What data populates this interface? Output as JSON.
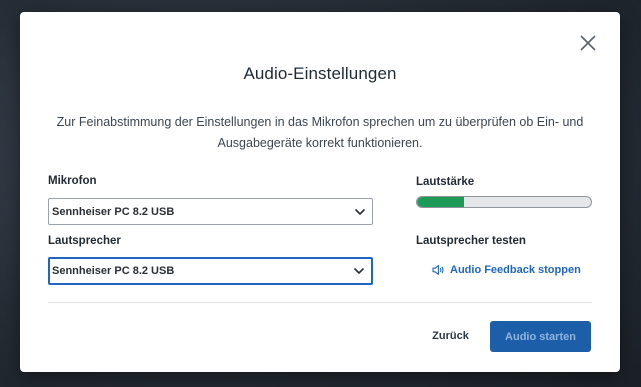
{
  "dialog": {
    "title": "Audio-Einstellungen",
    "description": "Zur Feinabstimmung der Einstellungen in das Mikrofon sprechen um zu überprüfen ob Ein- und Ausgabegeräte korrekt funktionieren.",
    "close_icon": "close-icon"
  },
  "microphone": {
    "label": "Mikrofon",
    "selected": "Sennheiser PC 8.2 USB",
    "icon": "chevron-down-icon"
  },
  "speaker": {
    "label": "Lautsprecher",
    "selected": "Sennheiser PC 8.2 USB",
    "icon": "chevron-down-icon"
  },
  "volume": {
    "label": "Lautstärke",
    "level": 0.27,
    "fill_color": "#1f9b58"
  },
  "speaker_test": {
    "label": "Lautsprecher testen",
    "link_label": "Audio Feedback stoppen",
    "icon": "speaker-icon"
  },
  "footer": {
    "back_label": "Zurück",
    "start_label": "Audio starten"
  },
  "colors": {
    "accent": "#1f66c2",
    "primary_button": "#1d5ea8",
    "meter_green": "#1f9b58"
  }
}
